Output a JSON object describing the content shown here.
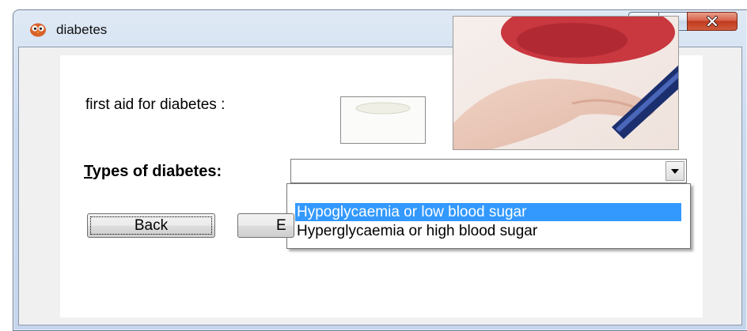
{
  "window": {
    "title": "diabetes",
    "app_icon": "owl-app-icon",
    "controls": {
      "minimize_icon": "minimize-icon",
      "maximize_icon": "maximize-icon",
      "close_icon": "close-icon"
    }
  },
  "form": {
    "first_aid_label": "first aid for diabetes :",
    "types_label": "Types of diabetes:",
    "combo_value": "",
    "dropdown_options": [
      "Hypoglycaemia or low blood sugar",
      "Hyperglycaemia or high blood sugar"
    ],
    "highlighted_option_index": 0,
    "back_button": "Back",
    "second_button": "E"
  },
  "colors": {
    "selection": "#3399ff",
    "close_button": "#c8452a",
    "client_background": "#f0f0f0"
  }
}
